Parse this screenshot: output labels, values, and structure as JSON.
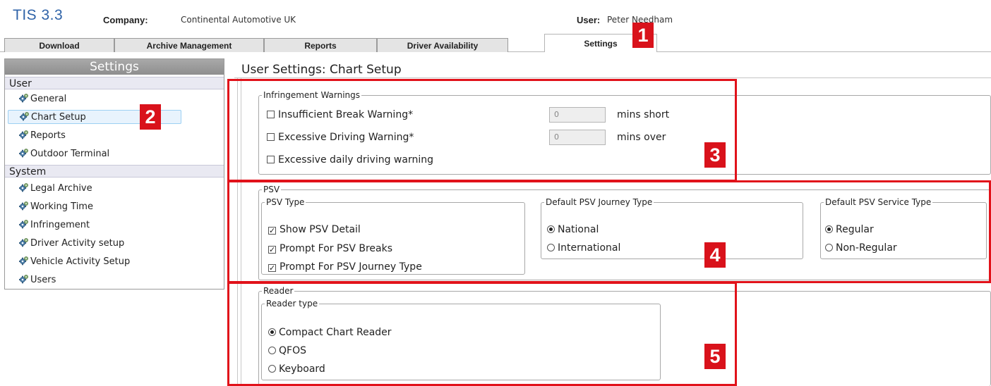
{
  "header": {
    "app_title": "TIS 3.3",
    "company_label": "Company:",
    "company_value": "Continental Automotive UK",
    "user_label": "User:",
    "user_value": "Peter Needham"
  },
  "tabs": [
    "Download",
    "Archive Management",
    "Reports",
    "Driver Availability",
    "Settings"
  ],
  "active_tab": "Settings",
  "sidebar": {
    "title": "Settings",
    "user_section": "User",
    "user_items": [
      "General",
      "Chart Setup",
      "Reports",
      "Outdoor Terminal"
    ],
    "selected_item": "Chart Setup",
    "system_section": "System",
    "system_items": [
      "Legal Archive",
      "Working Time",
      "Infringement",
      "Driver Activity setup",
      "Vehicle Activity Setup",
      "Users"
    ]
  },
  "page_title": "User Settings: Chart Setup",
  "infringement": {
    "legend": "Infringement Warnings",
    "insufficient_break": {
      "label": "Insufficient Break Warning*",
      "checked": false,
      "value": "0",
      "unit": "mins short"
    },
    "excessive_driving": {
      "label": "Excessive Driving Warning*",
      "checked": false,
      "value": "0",
      "unit": "mins over"
    },
    "excessive_daily": {
      "label": "Excessive daily driving warning",
      "checked": false
    }
  },
  "psv": {
    "legend": "PSV",
    "type_legend": "PSV Type",
    "show_detail": {
      "label": "Show PSV Detail",
      "checked": true
    },
    "prompt_breaks": {
      "label": "Prompt For PSV Breaks",
      "checked": true
    },
    "prompt_journey": {
      "label": "Prompt For PSV Journey Type",
      "checked": true
    },
    "journey_legend": "Default PSV Journey Type",
    "journey_options": [
      "National",
      "International"
    ],
    "journey_selected": "National",
    "service_legend": "Default PSV Service Type",
    "service_options": [
      "Regular",
      "Non-Regular"
    ],
    "service_selected": "Regular"
  },
  "reader": {
    "legend": "Reader",
    "type_legend": "Reader type",
    "options": [
      "Compact Chart Reader",
      "QFOS",
      "Keyboard"
    ],
    "selected": "Compact Chart Reader"
  },
  "annotations": {
    "badges": [
      "1",
      "2",
      "3",
      "4",
      "5"
    ],
    "color": "#e1121a"
  },
  "icons": {
    "sidebar_item": "gear-icon",
    "checkbox_mark": "✓"
  }
}
